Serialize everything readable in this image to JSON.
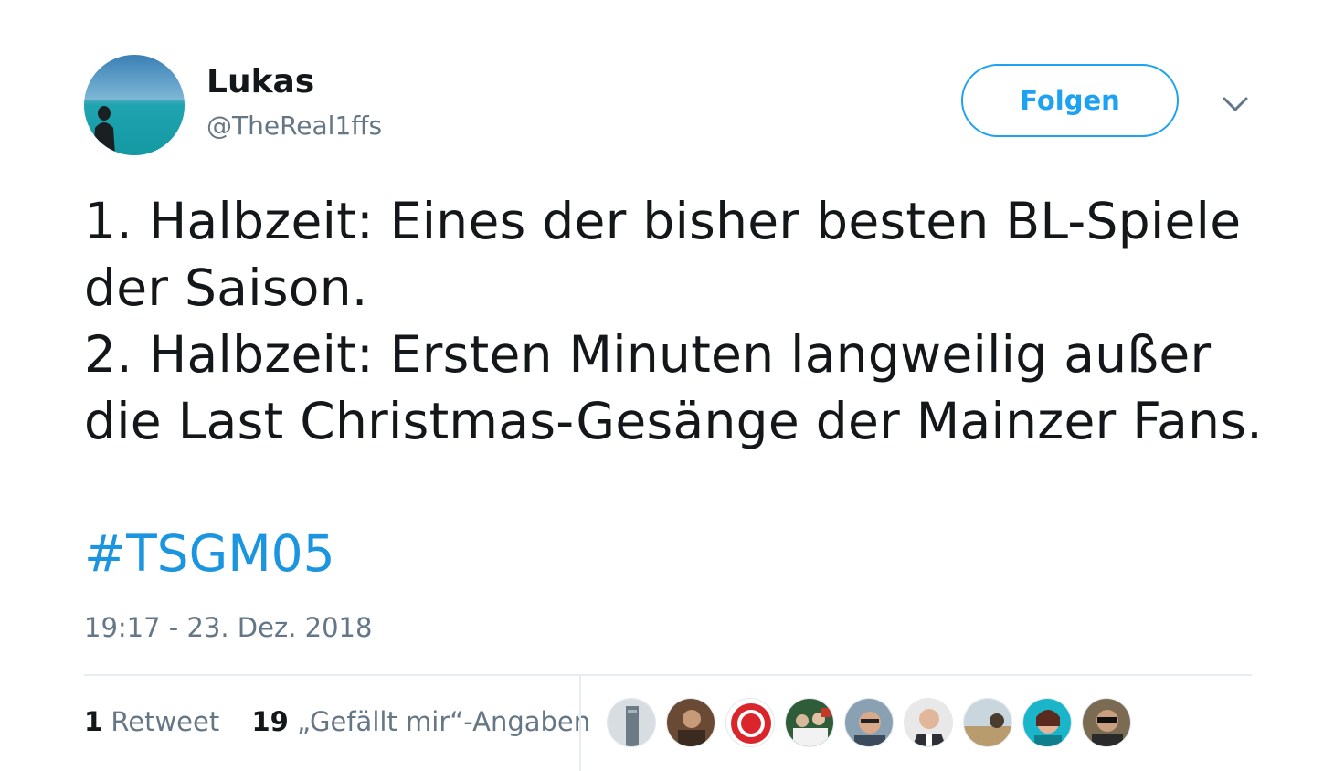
{
  "user": {
    "display_name": "Lukas",
    "handle": "@TheReal1ffs",
    "avatar_icon": "profile-photo-beach"
  },
  "follow_button": {
    "label": "Folgen"
  },
  "menu": {
    "icon": "chevron-down-icon"
  },
  "tweet": {
    "lines": [
      "1. Halbzeit: Eines der bisher besten BL-Spiele",
      "der Saison.",
      "2. Halbzeit: Ersten Minuten langweilig außer",
      "die Last Christmas-Gesänge der Mainzer Fans."
    ],
    "hashtag": "#TSGM05",
    "timestamp": "19:17 - 23. Dez. 2018"
  },
  "stats": {
    "retweets_count": "1",
    "retweets_label": "Retweet",
    "likes_count": "19",
    "likes_label": "„Gefällt mir“-Angaben"
  },
  "likers": [
    {
      "icon": "avatar-building"
    },
    {
      "icon": "avatar-person"
    },
    {
      "icon": "avatar-mainz05-logo"
    },
    {
      "icon": "avatar-group"
    },
    {
      "icon": "avatar-person-glasses"
    },
    {
      "icon": "avatar-person-suit"
    },
    {
      "icon": "avatar-landscape"
    },
    {
      "icon": "avatar-woman"
    },
    {
      "icon": "avatar-person-sunglasses"
    }
  ],
  "colors": {
    "accent": "#1da1f2",
    "hashtag": "#1b95e0",
    "text": "#14171a",
    "secondary": "#657786",
    "divider": "#e6ecf0"
  }
}
